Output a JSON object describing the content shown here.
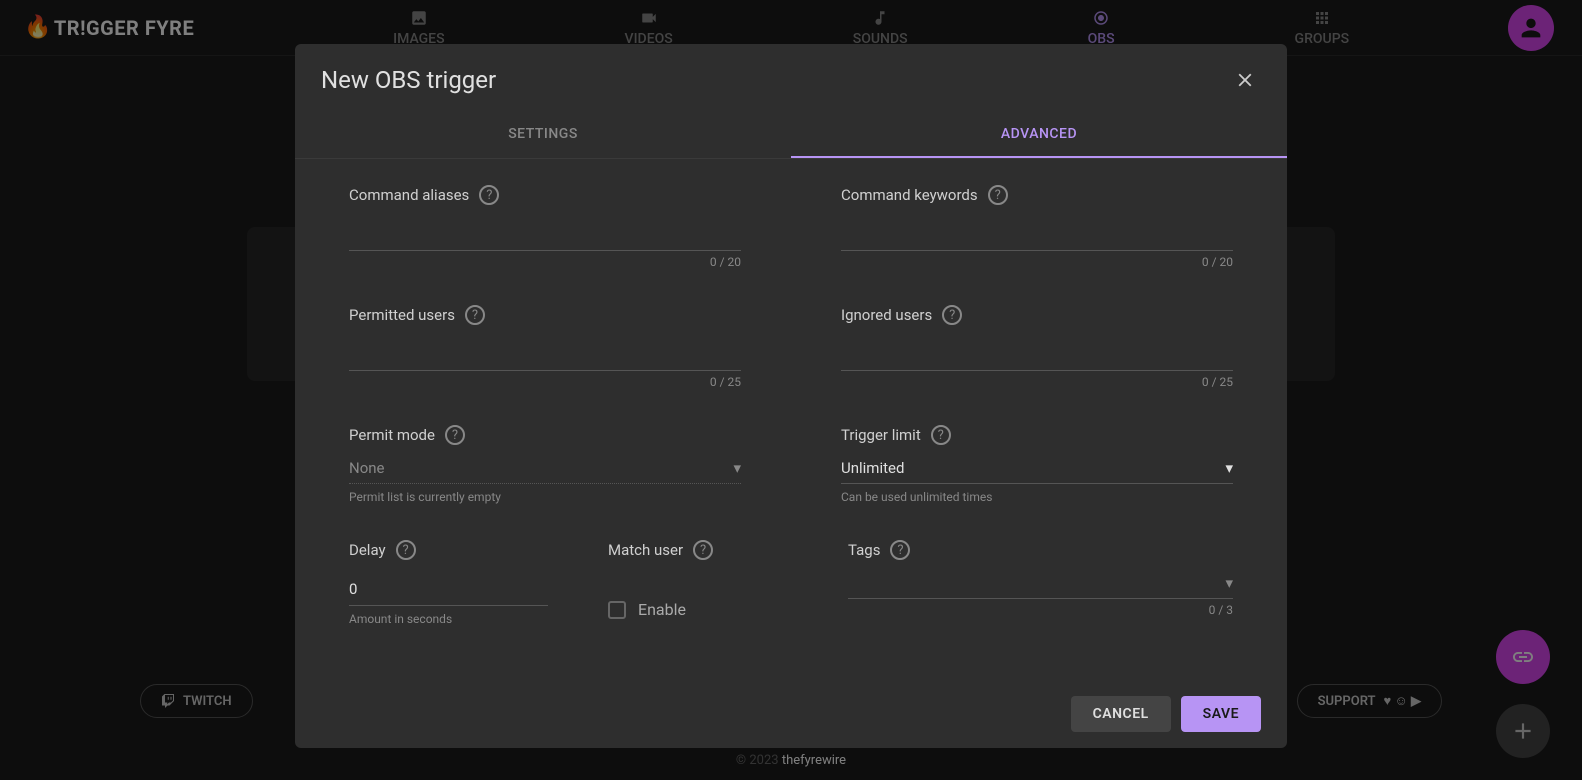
{
  "brand": "TR!GGER FYRE",
  "nav": [
    {
      "label": "IMAGES"
    },
    {
      "label": "VIDEOS"
    },
    {
      "label": "SOUNDS"
    },
    {
      "label": "OBS"
    },
    {
      "label": "GROUPS"
    }
  ],
  "footer": {
    "twitch": "TWITCH",
    "support": "SUPPORT",
    "copyright_prefix": "© 2023 ",
    "copyright_name": "thefyrewire"
  },
  "modal": {
    "title": "New OBS trigger",
    "tabs": {
      "settings": "SETTINGS",
      "advanced": "ADVANCED"
    },
    "fields": {
      "command_aliases": {
        "label": "Command aliases",
        "counter": "0 / 20"
      },
      "command_keywords": {
        "label": "Command keywords",
        "counter": "0 / 20"
      },
      "permitted_users": {
        "label": "Permitted users",
        "counter": "0 / 25"
      },
      "ignored_users": {
        "label": "Ignored users",
        "counter": "0 / 25"
      },
      "permit_mode": {
        "label": "Permit mode",
        "value": "None",
        "helper": "Permit list is currently empty"
      },
      "trigger_limit": {
        "label": "Trigger limit",
        "value": "Unlimited",
        "helper": "Can be used unlimited times"
      },
      "delay": {
        "label": "Delay",
        "value": "0",
        "helper": "Amount in seconds"
      },
      "match_user": {
        "label": "Match user",
        "checkbox_label": "Enable"
      },
      "tags": {
        "label": "Tags",
        "counter": "0 / 3"
      }
    },
    "actions": {
      "cancel": "CANCEL",
      "save": "SAVE"
    }
  }
}
